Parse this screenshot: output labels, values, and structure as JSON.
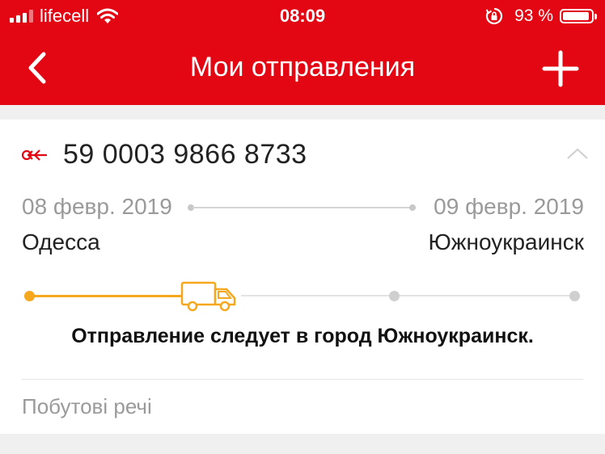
{
  "status_bar": {
    "carrier": "lifecell",
    "time": "08:09",
    "battery_percent": "93 %",
    "battery_level": 0.93,
    "signal_bars": 4,
    "signal_active": 3
  },
  "nav": {
    "title": "Мои отправления",
    "back_icon": "chevron-left-icon",
    "add_icon": "plus-icon"
  },
  "shipment": {
    "tracking_number": "59 0003 9866 8733",
    "direction_icon": "incoming-arrow-icon",
    "from_date": "08 февр. 2019",
    "to_date": "09 февр. 2019",
    "from_city": "Одесса",
    "to_city": "Южноукраинск",
    "status": "Отправление следует в город Южноукраинск.",
    "description": "Побутові речі",
    "progress_stage": 2,
    "progress_stages_total": 4
  },
  "colors": {
    "brand_red": "#e30613",
    "progress_orange": "#f5a81e",
    "muted_text": "#9a9a9a"
  }
}
